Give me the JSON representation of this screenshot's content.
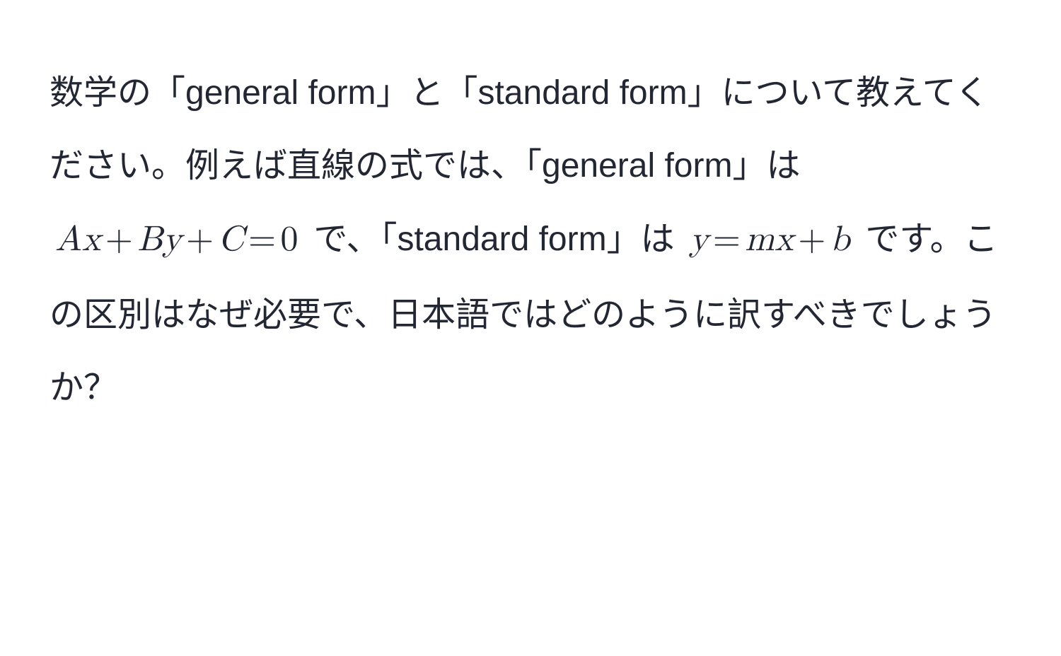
{
  "text": {
    "t1": "数学の「general form」と「standard form」について教えてください。例えば直線の式では、「general form」は ",
    "t2": " で、「standard form」は ",
    "t3": " です。この区別はなぜ必要で、日本語ではどのように訳すべきでしょうか？"
  },
  "math": {
    "eq1": {
      "A": "A",
      "x1": "x",
      "plus1": "+",
      "B": "B",
      "y": "y",
      "plus2": "+",
      "C": "C",
      "eq": "=",
      "zero": "0"
    },
    "eq2": {
      "y": "y",
      "eq": "=",
      "m": "m",
      "x": "x",
      "plus": "+",
      "b": "b"
    }
  }
}
